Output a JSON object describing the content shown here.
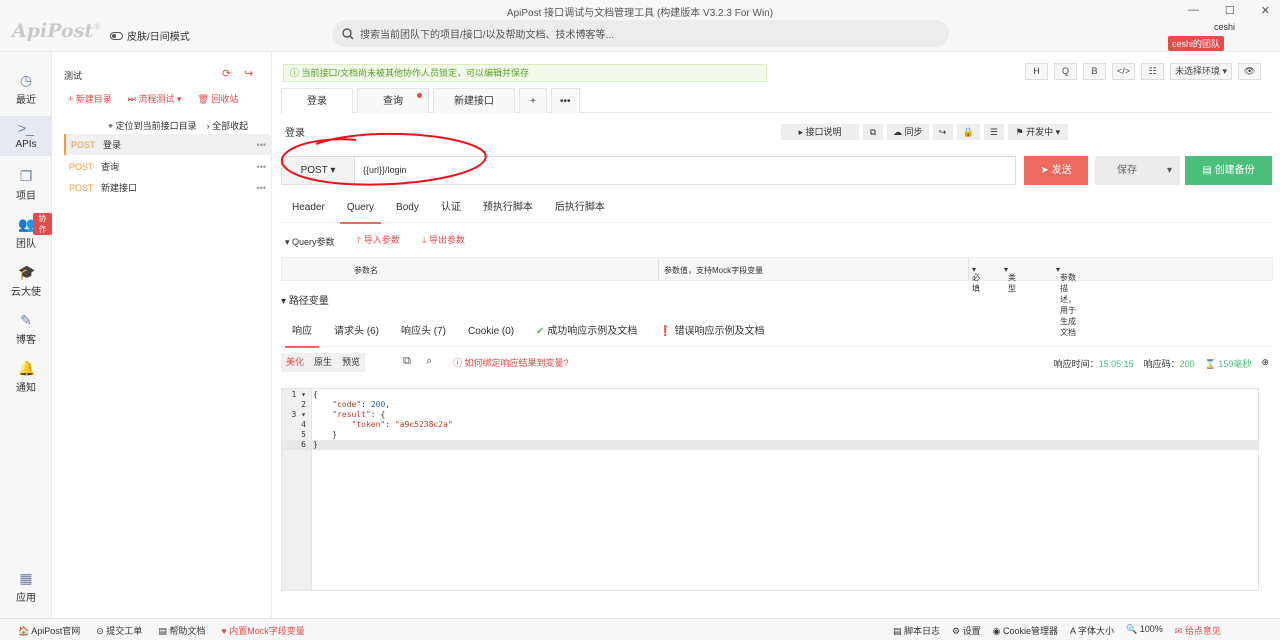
{
  "window": {
    "title": "ApiPost 接口调试与文档管理工具 (构建版本 V3.2.3 For Win)",
    "min": "—",
    "max": "☐",
    "close": "✕"
  },
  "header": {
    "logo": "ApiPost",
    "logo_mark": "®",
    "skin_label": "皮肤/日间模式",
    "search_placeholder": "搜索当前团队下的项目/接口/以及帮助文档、技术博客等...",
    "user": "ceshi",
    "team": "ceshi的团队"
  },
  "rail": [
    {
      "label": "最近",
      "icon": "clock-icon"
    },
    {
      "label": "APIs",
      "icon": "terminal-icon"
    },
    {
      "label": "项目",
      "icon": "projects-icon"
    },
    {
      "label": "团队",
      "icon": "team-icon",
      "badge": "协作"
    },
    {
      "label": "云大使",
      "icon": "graduation-cap-icon"
    },
    {
      "label": "博客",
      "icon": "edit-icon"
    },
    {
      "label": "通知",
      "icon": "bell-icon"
    },
    {
      "label": "应用",
      "icon": "grid-icon"
    }
  ],
  "tree": {
    "project": "测试",
    "actions": {
      "new_dir": "新建目录",
      "flow_test": "流程测试",
      "recycle": "回收站"
    },
    "locate": "定位到当前接口目录",
    "collapse": "全部收起",
    "apis": [
      {
        "method": "POST",
        "name": "登录"
      },
      {
        "method": "POST",
        "name": "查询"
      },
      {
        "method": "POST",
        "name": "新建接口"
      }
    ]
  },
  "notice": "当前接口/文档尚未被其他协作人员锁定，可以编辑并保存",
  "format_buttons": [
    "H",
    "Q",
    "B",
    "</>",
    "☷"
  ],
  "env": "未选择环境",
  "tabs": [
    {
      "label": "登录"
    },
    {
      "label": "查询"
    },
    {
      "label": "新建接口"
    }
  ],
  "tab_add": "+",
  "tab_more": "•••",
  "request": {
    "name": "登录",
    "doc_btn": "接口说明",
    "sync": "同步",
    "status": "开发中",
    "method": "POST",
    "url": "{{url}}/login",
    "send": "发送",
    "save": "保存",
    "backup": "创建备份"
  },
  "req_tabs": [
    "Header",
    "Query",
    "Body",
    "认证",
    "预执行脚本",
    "后执行脚本"
  ],
  "query": {
    "title": "Query参数",
    "import": "导入参数",
    "export": "导出参数",
    "col_name": "参数名",
    "col_value": "参数值，支持Mock字段变量",
    "col_required": "必填",
    "col_type": "类型",
    "col_desc": "参数描述，用于生成文档"
  },
  "path_vars": "路径变量",
  "resp_tabs": [
    "响应",
    "请求头 (6)",
    "响应头 (7)",
    "Cookie (0)",
    "成功响应示例及文档",
    "错误响应示例及文档"
  ],
  "response": {
    "views": [
      "美化",
      "原生",
      "预览"
    ],
    "help": "如何绑定响应结果到变量?",
    "time_label": "响应时间：",
    "time": "15:05:15",
    "code_label": "响应码：",
    "code": "200",
    "duration": "159毫秒"
  },
  "code_lines": [
    {
      "n": "1",
      "text": "{"
    },
    {
      "n": "2",
      "key": "\"code\"",
      "val": "200",
      "type": "num",
      "indent": "    "
    },
    {
      "n": "3",
      "key": "\"result\"",
      "val": "{",
      "type": "plain",
      "indent": "    "
    },
    {
      "n": "4",
      "key": "\"token\"",
      "val": "\"a9c5238c2a\"",
      "type": "str",
      "indent": "        "
    },
    {
      "n": "5",
      "text": "    }"
    },
    {
      "n": "6",
      "text": "}"
    }
  ],
  "status": {
    "left": [
      "ApiPost官网",
      "提交工单",
      "帮助文档",
      "内置Mock字段变量"
    ],
    "right": [
      "脚本日志",
      "设置",
      "Cookie管理器",
      "字体大小",
      "100%",
      "给点意见"
    ]
  }
}
